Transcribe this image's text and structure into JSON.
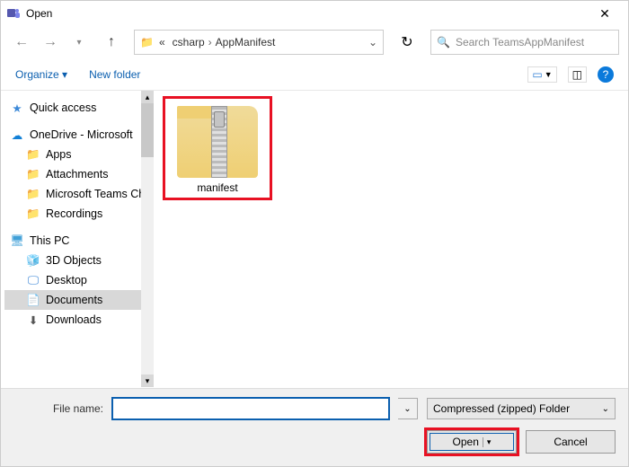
{
  "window": {
    "title": "Open"
  },
  "nav": {
    "breadcrumb": {
      "prefix": "«",
      "part1": "csharp",
      "part2": "AppManifest"
    },
    "search_placeholder": "Search TeamsAppManifest"
  },
  "toolbar": {
    "organize": "Organize",
    "new_folder": "New folder"
  },
  "sidebar": {
    "quick_access": "Quick access",
    "onedrive": "OneDrive - Microsoft",
    "apps": "Apps",
    "attachments": "Attachments",
    "ms_teams": "Microsoft Teams Chat Files",
    "recordings": "Recordings",
    "this_pc": "This PC",
    "objects3d": "3D Objects",
    "desktop": "Desktop",
    "documents": "Documents",
    "downloads": "Downloads"
  },
  "files": {
    "items": [
      {
        "name": "manifest",
        "type": "zip"
      }
    ]
  },
  "footer": {
    "filename_label": "File name:",
    "filename_value": "",
    "filter": "Compressed (zipped) Folder",
    "open": "Open",
    "cancel": "Cancel"
  }
}
